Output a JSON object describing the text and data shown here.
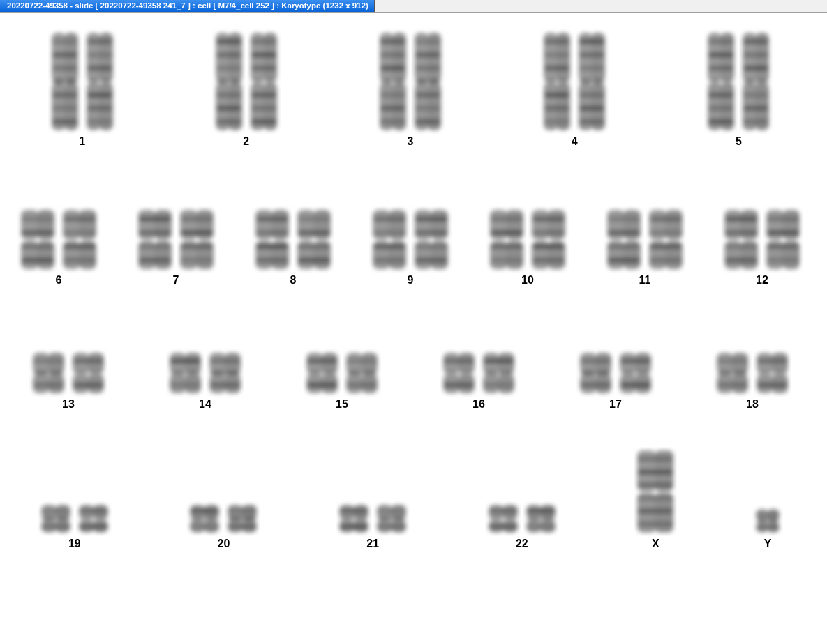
{
  "window": {
    "title": "20220722-49358 - slide [ 20220722-49358 241_7 ] : cell [ M7/4_cell 252 ] : Karyotype  (1232 x 912)"
  },
  "karyotype": {
    "rows": [
      [
        {
          "label": "1",
          "kind": "pair"
        },
        {
          "label": "2",
          "kind": "pair"
        },
        {
          "label": "3",
          "kind": "pair"
        },
        {
          "label": "4",
          "kind": "pair"
        },
        {
          "label": "5",
          "kind": "pair"
        }
      ],
      [
        {
          "label": "6",
          "kind": "pair"
        },
        {
          "label": "7",
          "kind": "pair"
        },
        {
          "label": "8",
          "kind": "pair"
        },
        {
          "label": "9",
          "kind": "pair"
        },
        {
          "label": "10",
          "kind": "pair"
        },
        {
          "label": "11",
          "kind": "pair"
        },
        {
          "label": "12",
          "kind": "pair"
        }
      ],
      [
        {
          "label": "13",
          "kind": "pair"
        },
        {
          "label": "14",
          "kind": "pair"
        },
        {
          "label": "15",
          "kind": "pair"
        },
        {
          "label": "16",
          "kind": "pair"
        },
        {
          "label": "17",
          "kind": "pair"
        },
        {
          "label": "18",
          "kind": "pair"
        }
      ],
      [
        {
          "label": "19",
          "kind": "pair"
        },
        {
          "label": "20",
          "kind": "pair"
        },
        {
          "label": "21",
          "kind": "pair"
        },
        {
          "label": "22",
          "kind": "pair"
        },
        {
          "label": "X",
          "kind": "single"
        },
        {
          "label": "Y",
          "kind": "single"
        }
      ]
    ]
  }
}
